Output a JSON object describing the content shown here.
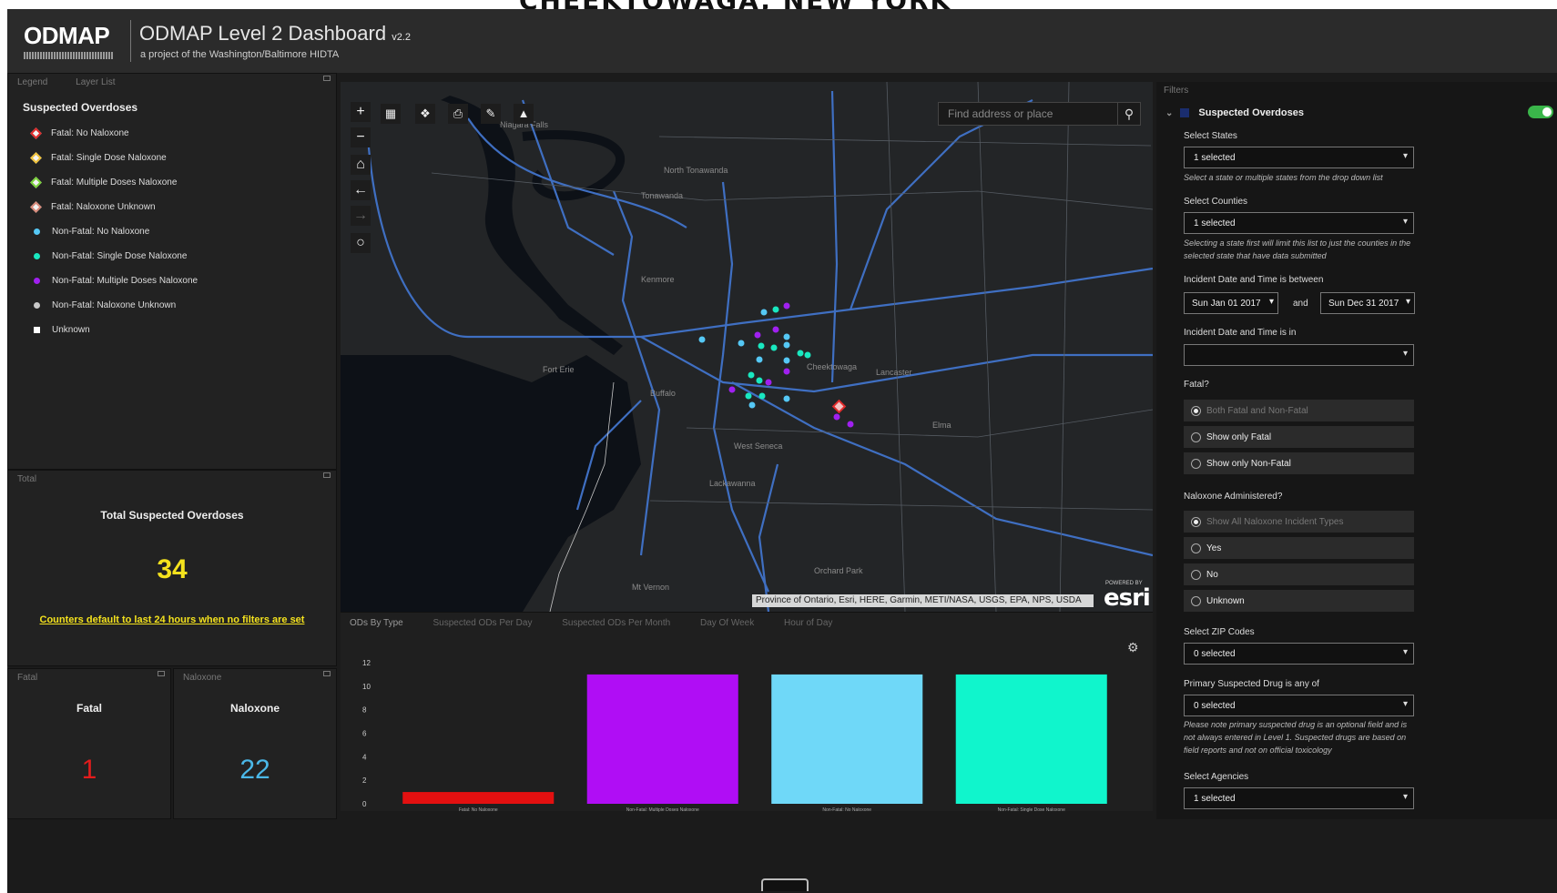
{
  "banner": {
    "text": "CHEEKTOWAGA, NEW YORK"
  },
  "header": {
    "logo_text": "ODMAP",
    "title": "ODMAP Level 2 Dashboard",
    "version": "v2.2",
    "subtitle": "a project of the Washington/Baltimore HIDTA"
  },
  "legend_panel": {
    "tabs": [
      "Legend",
      "Layer List"
    ],
    "title": "Suspected Overdoses",
    "items": [
      {
        "label": "Fatal: No Naloxone",
        "shape": "diamond",
        "color": "#e02b2b"
      },
      {
        "label": "Fatal: Single Dose Naloxone",
        "shape": "diamond",
        "color": "#f0c23a"
      },
      {
        "label": "Fatal: Multiple Doses Naloxone",
        "shape": "diamond",
        "color": "#7bd43a"
      },
      {
        "label": "Fatal: Naloxone Unknown",
        "shape": "diamond",
        "color": "#d98a7a"
      },
      {
        "label": "Non-Fatal: No Naloxone",
        "shape": "dot",
        "color": "#55c8f5"
      },
      {
        "label": "Non-Fatal: Single Dose Naloxone",
        "shape": "dot",
        "color": "#19e8c0"
      },
      {
        "label": "Non-Fatal: Multiple Doses Naloxone",
        "shape": "dot",
        "color": "#a020f0"
      },
      {
        "label": "Non-Fatal: Naloxone Unknown",
        "shape": "dot",
        "color": "#c8c8c8"
      },
      {
        "label": "Unknown",
        "shape": "square",
        "color": "#ffffff"
      }
    ]
  },
  "total_panel": {
    "tab": "Total",
    "title": "Total Suspected Overdoses",
    "value": "34",
    "note": "Counters default to last 24 hours when no filters are set"
  },
  "fatal_panel": {
    "tab": "Fatal",
    "title": "Fatal",
    "value": "1"
  },
  "naloxone_panel": {
    "tab": "Naloxone",
    "title": "Naloxone",
    "value": "22"
  },
  "map": {
    "search_placeholder": "Find address or place",
    "attribution": "Province of Ontario, Esri, HERE, Garmin, METI/NASA, USGS, EPA, NPS, USDA",
    "esri_small": "POWERED BY",
    "esri": "esri",
    "place_labels": [
      {
        "text": "North Tonawanda"
      },
      {
        "text": "Tonawanda"
      },
      {
        "text": "Kenmore"
      },
      {
        "text": "Cheektowaga"
      },
      {
        "text": "Buffalo"
      },
      {
        "text": "Lancaster"
      },
      {
        "text": "West Seneca"
      },
      {
        "text": "Lackawanna"
      },
      {
        "text": "Fort Erie"
      },
      {
        "text": "Niagara Falls"
      },
      {
        "text": "Mt Vernon"
      },
      {
        "text": "Elma"
      },
      {
        "text": "Orchard Park"
      }
    ],
    "tools": [
      "zoom-in",
      "zoom-out",
      "home",
      "back",
      "forward",
      "locate"
    ],
    "top_tools": [
      "basemap-gallery",
      "layers",
      "print",
      "draw",
      "measure"
    ]
  },
  "chart_panel": {
    "tabs": [
      "ODs By Type",
      "Suspected ODs Per Day",
      "Suspected ODs Per Month",
      "Day Of Week",
      "Hour of Day"
    ],
    "active_tab": 0
  },
  "chart_data": {
    "type": "bar",
    "categories": [
      "Fatal: No Naloxone",
      "Non-Fatal: Multiple Doses Naloxone",
      "Non-Fatal: No Naloxone",
      "Non-Fatal: Single Dose Naloxone"
    ],
    "values": [
      1,
      11,
      11,
      11
    ],
    "colors": [
      "#e31010",
      "#b00df5",
      "#6fd8f8",
      "#10f5cc"
    ],
    "yticks": [
      0,
      2,
      4,
      6,
      8,
      10,
      12
    ],
    "ylim": [
      0,
      12
    ],
    "title": "",
    "xlabel": "",
    "ylabel": ""
  },
  "filters": {
    "tab": "Filters",
    "layer_label": "Suspected Overdoses",
    "toggle_on": true,
    "select_states_label": "Select States",
    "select_states_value": "1 selected",
    "select_states_note": "Select a state or multiple states from the drop down list",
    "select_counties_label": "Select Counties",
    "select_counties_value": "1 selected",
    "select_counties_note": "Selecting a state first will limit this list to just the counties in the selected state that have data submitted",
    "date_between_label": "Incident Date and Time is between",
    "date_start": "Sun Jan 01 2017",
    "date_and": "and",
    "date_end": "Sun Dec 31 2017",
    "date_in_label": "Incident Date and Time is in",
    "date_in_value": "",
    "fatal_label": "Fatal?",
    "fatal_options": [
      "Both Fatal and Non-Fatal",
      "Show only Fatal",
      "Show only Non-Fatal"
    ],
    "naloxone_label": "Naloxone Administered?",
    "naloxone_options": [
      "Show All Naloxone Incident Types",
      "Yes",
      "No",
      "Unknown"
    ],
    "zip_label": "Select ZIP Codes",
    "zip_value": "0 selected",
    "drug_label": "Primary Suspected Drug is any of",
    "drug_value": "0 selected",
    "drug_note": "Please note primary suspected drug is an optional field and is not always entered in Level 1. Suspected drugs are based on field reports and not on official toxicology",
    "agencies_label": "Select Agencies",
    "agencies_value": "1 selected"
  }
}
